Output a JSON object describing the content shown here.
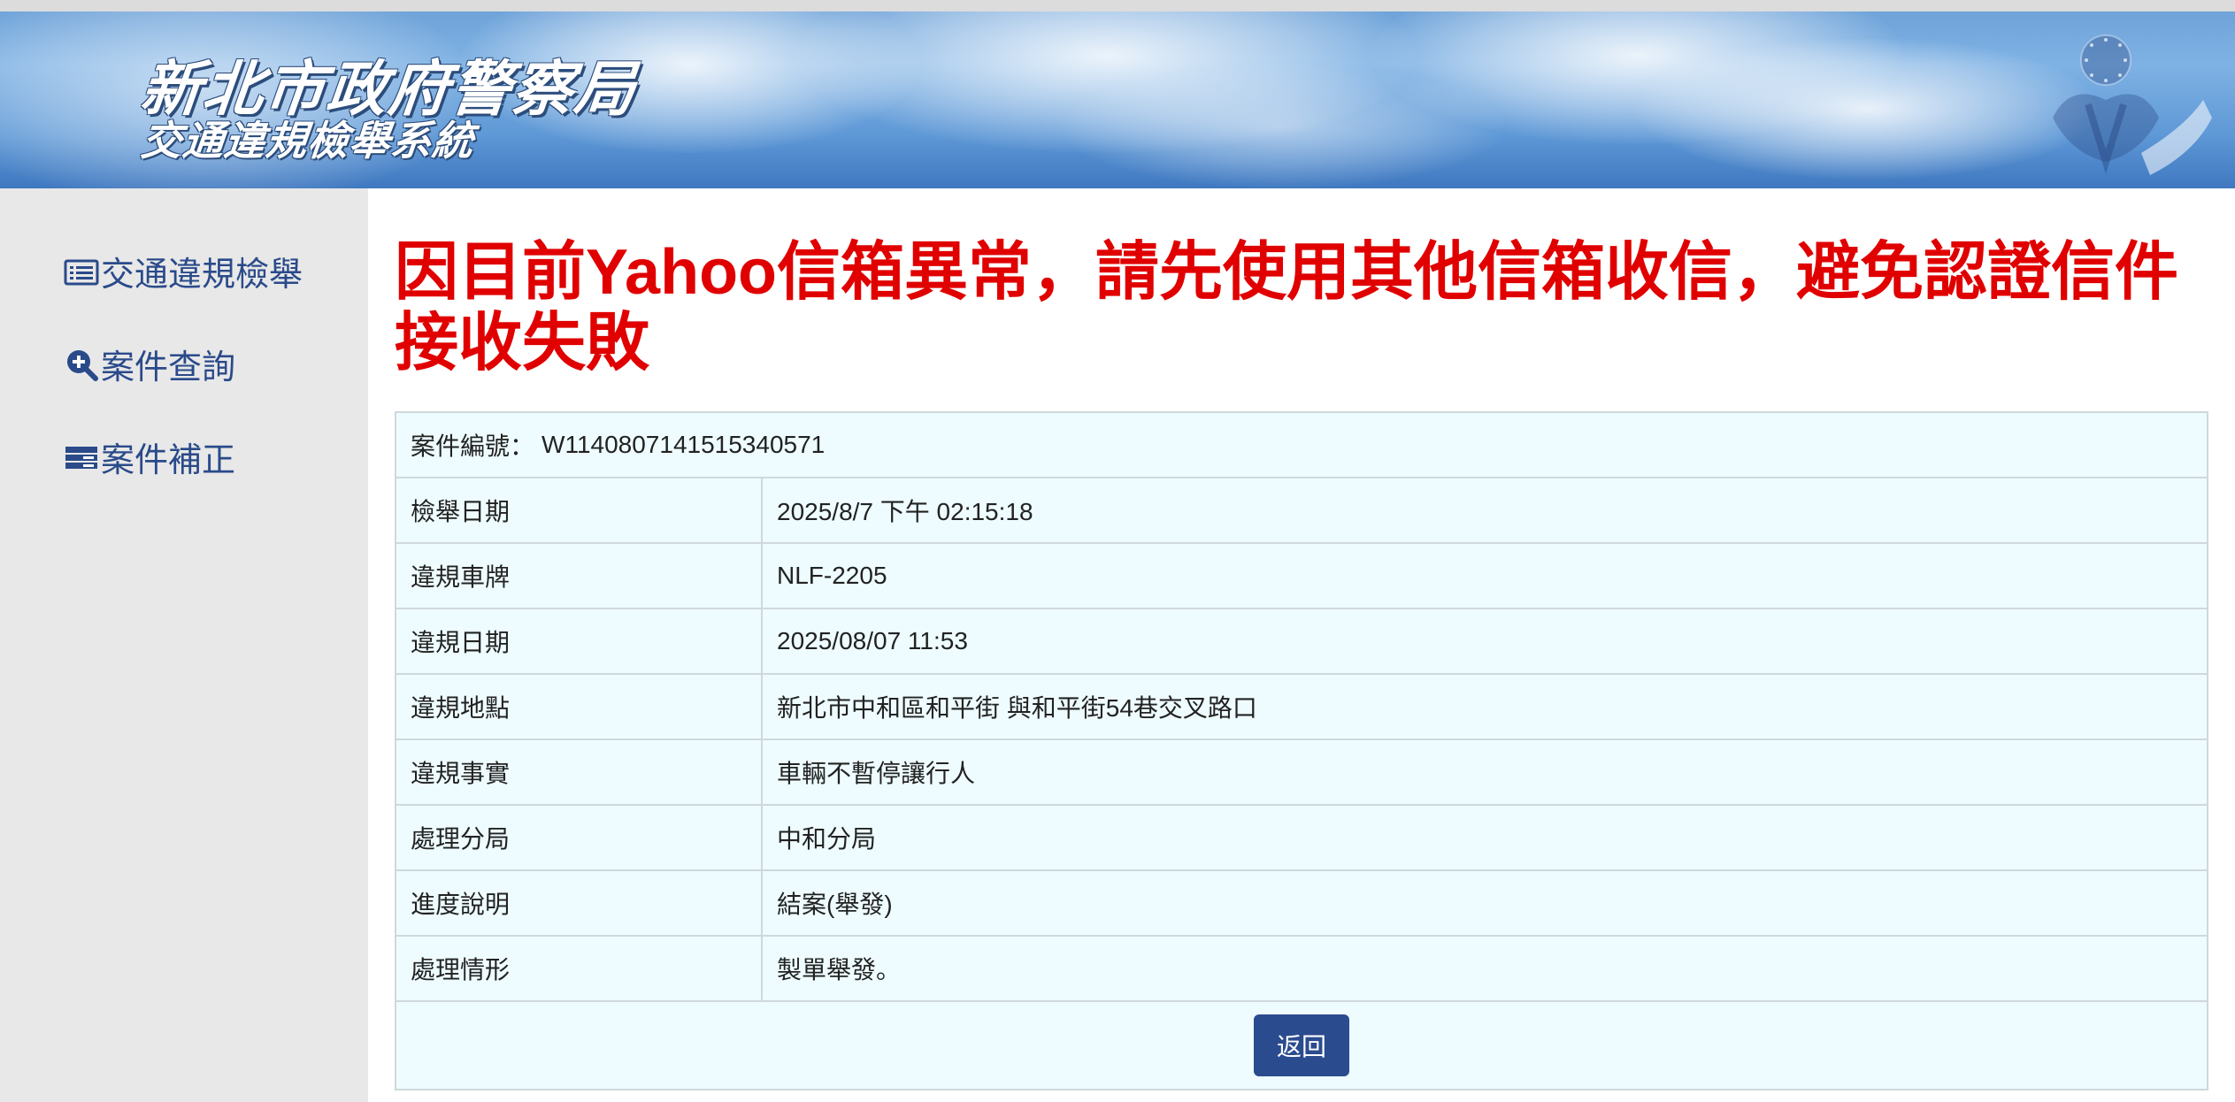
{
  "header": {
    "title": "新北市政府警察局",
    "subtitle": "交通違規檢舉系統",
    "emblem_icon": "police-emblem-icon"
  },
  "sidebar": {
    "items": [
      {
        "label": "交通違規檢舉",
        "icon": "list-icon"
      },
      {
        "label": "案件查詢",
        "icon": "search-plus-icon"
      },
      {
        "label": "案件補正",
        "icon": "stack-icon"
      }
    ]
  },
  "main": {
    "alert": "因目前Yahoo信箱異常，請先使用其他信箱收信，避免認證信件接收失敗",
    "case_number_label": "案件編號：",
    "case_number": "W1140807141515340571",
    "rows": [
      {
        "label": "檢舉日期",
        "value": "2025/8/7 下午 02:15:18"
      },
      {
        "label": "違規車牌",
        "value": "NLF-2205"
      },
      {
        "label": "違規日期",
        "value": "2025/08/07 11:53"
      },
      {
        "label": "違規地點",
        "value": "新北市中和區和平街 與和平街54巷交叉路口"
      },
      {
        "label": "違規事實",
        "value": "車輛不暫停讓行人"
      },
      {
        "label": "處理分局",
        "value": "中和分局"
      },
      {
        "label": "進度說明",
        "value": "結案(舉發)"
      },
      {
        "label": "處理情形",
        "value": "製單舉發。"
      }
    ],
    "back_button": "返回"
  },
  "colors": {
    "alert_red": "#e00000",
    "nav_blue": "#2a4a8a",
    "button_blue": "#2b4b8f",
    "table_bg": "#eefcff"
  }
}
